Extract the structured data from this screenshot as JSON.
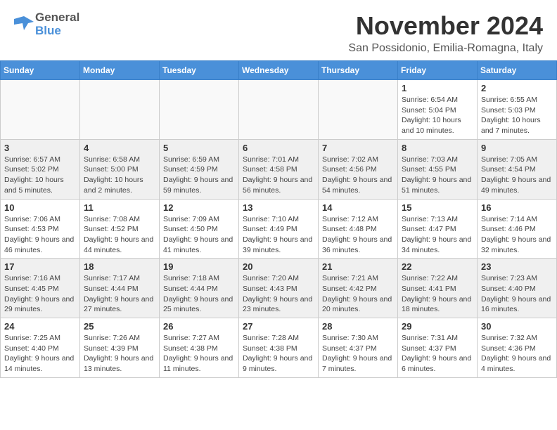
{
  "header": {
    "month_title": "November 2024",
    "location": "San Possidonio, Emilia-Romagna, Italy",
    "logo_general": "General",
    "logo_blue": "Blue"
  },
  "weekdays": [
    "Sunday",
    "Monday",
    "Tuesday",
    "Wednesday",
    "Thursday",
    "Friday",
    "Saturday"
  ],
  "weeks": [
    [
      {
        "day": "",
        "info": ""
      },
      {
        "day": "",
        "info": ""
      },
      {
        "day": "",
        "info": ""
      },
      {
        "day": "",
        "info": ""
      },
      {
        "day": "",
        "info": ""
      },
      {
        "day": "1",
        "info": "Sunrise: 6:54 AM\nSunset: 5:04 PM\nDaylight: 10 hours and 10 minutes."
      },
      {
        "day": "2",
        "info": "Sunrise: 6:55 AM\nSunset: 5:03 PM\nDaylight: 10 hours and 7 minutes."
      }
    ],
    [
      {
        "day": "3",
        "info": "Sunrise: 6:57 AM\nSunset: 5:02 PM\nDaylight: 10 hours and 5 minutes."
      },
      {
        "day": "4",
        "info": "Sunrise: 6:58 AM\nSunset: 5:00 PM\nDaylight: 10 hours and 2 minutes."
      },
      {
        "day": "5",
        "info": "Sunrise: 6:59 AM\nSunset: 4:59 PM\nDaylight: 9 hours and 59 minutes."
      },
      {
        "day": "6",
        "info": "Sunrise: 7:01 AM\nSunset: 4:58 PM\nDaylight: 9 hours and 56 minutes."
      },
      {
        "day": "7",
        "info": "Sunrise: 7:02 AM\nSunset: 4:56 PM\nDaylight: 9 hours and 54 minutes."
      },
      {
        "day": "8",
        "info": "Sunrise: 7:03 AM\nSunset: 4:55 PM\nDaylight: 9 hours and 51 minutes."
      },
      {
        "day": "9",
        "info": "Sunrise: 7:05 AM\nSunset: 4:54 PM\nDaylight: 9 hours and 49 minutes."
      }
    ],
    [
      {
        "day": "10",
        "info": "Sunrise: 7:06 AM\nSunset: 4:53 PM\nDaylight: 9 hours and 46 minutes."
      },
      {
        "day": "11",
        "info": "Sunrise: 7:08 AM\nSunset: 4:52 PM\nDaylight: 9 hours and 44 minutes."
      },
      {
        "day": "12",
        "info": "Sunrise: 7:09 AM\nSunset: 4:50 PM\nDaylight: 9 hours and 41 minutes."
      },
      {
        "day": "13",
        "info": "Sunrise: 7:10 AM\nSunset: 4:49 PM\nDaylight: 9 hours and 39 minutes."
      },
      {
        "day": "14",
        "info": "Sunrise: 7:12 AM\nSunset: 4:48 PM\nDaylight: 9 hours and 36 minutes."
      },
      {
        "day": "15",
        "info": "Sunrise: 7:13 AM\nSunset: 4:47 PM\nDaylight: 9 hours and 34 minutes."
      },
      {
        "day": "16",
        "info": "Sunrise: 7:14 AM\nSunset: 4:46 PM\nDaylight: 9 hours and 32 minutes."
      }
    ],
    [
      {
        "day": "17",
        "info": "Sunrise: 7:16 AM\nSunset: 4:45 PM\nDaylight: 9 hours and 29 minutes."
      },
      {
        "day": "18",
        "info": "Sunrise: 7:17 AM\nSunset: 4:44 PM\nDaylight: 9 hours and 27 minutes."
      },
      {
        "day": "19",
        "info": "Sunrise: 7:18 AM\nSunset: 4:44 PM\nDaylight: 9 hours and 25 minutes."
      },
      {
        "day": "20",
        "info": "Sunrise: 7:20 AM\nSunset: 4:43 PM\nDaylight: 9 hours and 23 minutes."
      },
      {
        "day": "21",
        "info": "Sunrise: 7:21 AM\nSunset: 4:42 PM\nDaylight: 9 hours and 20 minutes."
      },
      {
        "day": "22",
        "info": "Sunrise: 7:22 AM\nSunset: 4:41 PM\nDaylight: 9 hours and 18 minutes."
      },
      {
        "day": "23",
        "info": "Sunrise: 7:23 AM\nSunset: 4:40 PM\nDaylight: 9 hours and 16 minutes."
      }
    ],
    [
      {
        "day": "24",
        "info": "Sunrise: 7:25 AM\nSunset: 4:40 PM\nDaylight: 9 hours and 14 minutes."
      },
      {
        "day": "25",
        "info": "Sunrise: 7:26 AM\nSunset: 4:39 PM\nDaylight: 9 hours and 13 minutes."
      },
      {
        "day": "26",
        "info": "Sunrise: 7:27 AM\nSunset: 4:38 PM\nDaylight: 9 hours and 11 minutes."
      },
      {
        "day": "27",
        "info": "Sunrise: 7:28 AM\nSunset: 4:38 PM\nDaylight: 9 hours and 9 minutes."
      },
      {
        "day": "28",
        "info": "Sunrise: 7:30 AM\nSunset: 4:37 PM\nDaylight: 9 hours and 7 minutes."
      },
      {
        "day": "29",
        "info": "Sunrise: 7:31 AM\nSunset: 4:37 PM\nDaylight: 9 hours and 6 minutes."
      },
      {
        "day": "30",
        "info": "Sunrise: 7:32 AM\nSunset: 4:36 PM\nDaylight: 9 hours and 4 minutes."
      }
    ]
  ]
}
